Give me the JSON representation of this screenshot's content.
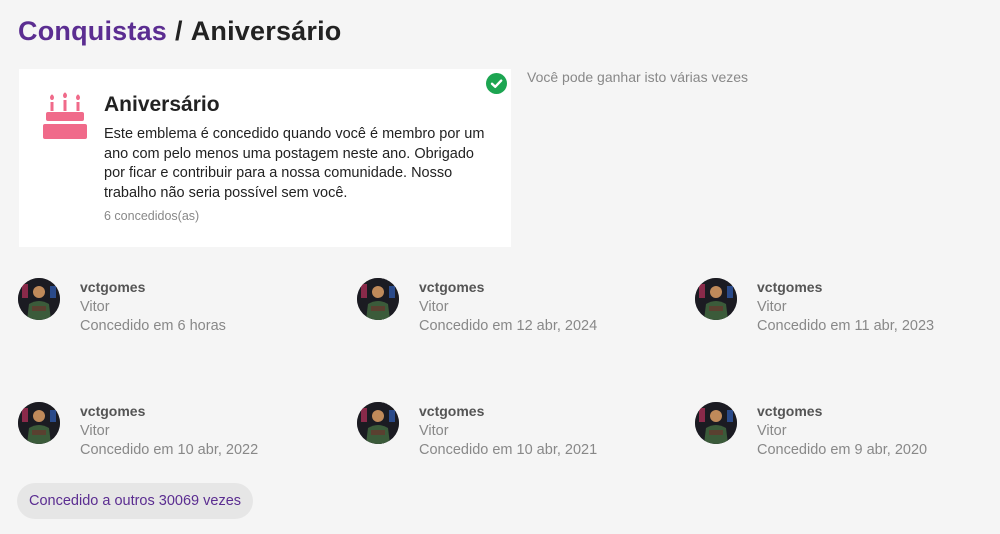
{
  "breadcrumb": {
    "parent": "Conquistas",
    "separator": "/",
    "current": "Aniversário"
  },
  "badge": {
    "icon": "birthday-cake-icon",
    "icon_color": "#f06a8a",
    "name": "Aniversário",
    "description": "Este emblema é concedido quando você é membro por um ano com pelo menos uma postagem neste ano. Obrigado por ficar e contribuir para a nossa comunidade. Nosso trabalho não seria possível sem você.",
    "granted_count": "6 concedidos(as)",
    "earned": true,
    "earned_icon": "check-circle-icon",
    "earned_color": "#1ca551"
  },
  "repeat_note": "Você pode ganhar isto várias vezes",
  "grants": [
    {
      "username": "vctgomes",
      "name": "Vitor",
      "granted": "Concedido em 6 horas"
    },
    {
      "username": "vctgomes",
      "name": "Vitor",
      "granted": "Concedido em 12 abr, 2024"
    },
    {
      "username": "vctgomes",
      "name": "Vitor",
      "granted": "Concedido em 11 abr, 2023"
    },
    {
      "username": "vctgomes",
      "name": "Vitor",
      "granted": "Concedido em 10 abr, 2022"
    },
    {
      "username": "vctgomes",
      "name": "Vitor",
      "granted": "Concedido em 10 abr, 2021"
    },
    {
      "username": "vctgomes",
      "name": "Vitor",
      "granted": "Concedido em 9 abr, 2020"
    }
  ],
  "more_button": "Concedido a outros 30069 vezes",
  "colors": {
    "accent": "#5b2d91",
    "background": "#f5f5f5"
  }
}
